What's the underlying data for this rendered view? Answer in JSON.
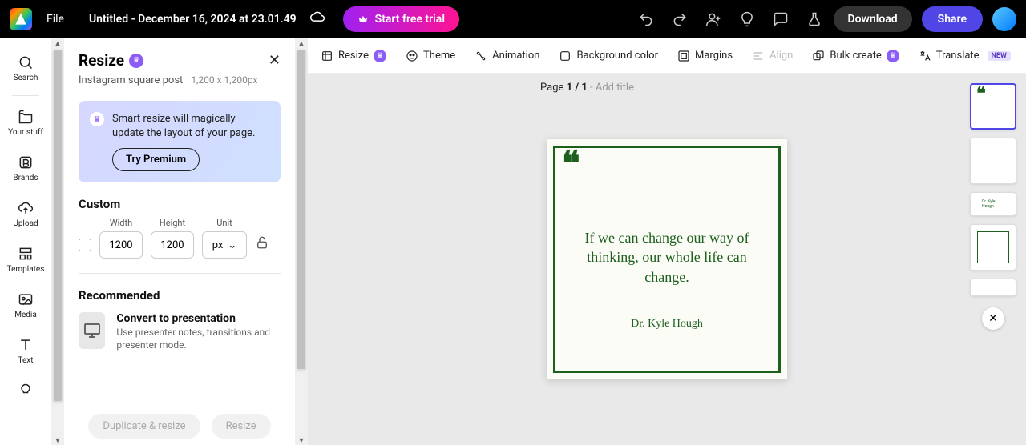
{
  "topbar": {
    "file": "File",
    "title": "Untitled - December 16, 2024 at 23.01.49",
    "trial": "Start free trial",
    "download": "Download",
    "share": "Share"
  },
  "leftnav": {
    "search": "Search",
    "yourstuff": "Your stuff",
    "brands": "Brands",
    "upload": "Upload",
    "templates": "Templates",
    "media": "Media",
    "text": "Text"
  },
  "panel": {
    "title": "Resize",
    "subtitle": "Instagram square post",
    "dimensions": "1,200 x 1,200px",
    "promo_text": "Smart resize will magically update the layout of your page.",
    "try_premium": "Try Premium",
    "custom": "Custom",
    "width_label": "Width",
    "height_label": "Height",
    "unit_label": "Unit",
    "width": "1200",
    "height": "1200",
    "unit": "px",
    "recommended": "Recommended",
    "rec_title": "Convert to presentation",
    "rec_desc": "Use presenter notes, transitions and presenter mode.",
    "dup_btn": "Duplicate & resize",
    "resize_btn": "Resize"
  },
  "context": {
    "resize": "Resize",
    "theme": "Theme",
    "animation": "Animation",
    "bgcolor": "Background color",
    "margins": "Margins",
    "align": "Align",
    "bulk": "Bulk create",
    "translate": "Translate",
    "new": "NEW"
  },
  "canvas": {
    "page_prefix": "Page ",
    "page_num": "1 / 1",
    "add_title": " - Add title",
    "quote": "If we can change our way of thinking, our whole life can change.",
    "author": "Dr. Kyle Hough"
  }
}
